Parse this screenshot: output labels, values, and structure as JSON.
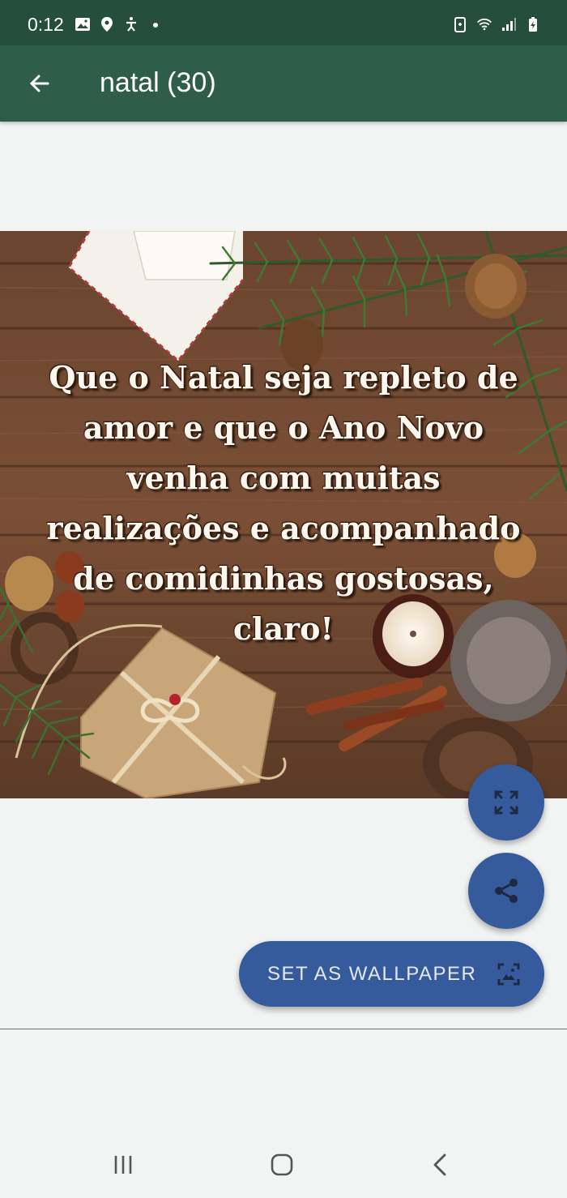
{
  "status_bar": {
    "time": "0:12",
    "left_icons": [
      "gallery-icon",
      "location-icon",
      "accessibility-icon",
      "dot-icon"
    ],
    "right_icons": [
      "battery-saver-icon",
      "wifi-icon",
      "signal-icon",
      "battery-icon"
    ]
  },
  "app_bar": {
    "title": "natal (30)",
    "back_icon": "arrow-left-icon",
    "color": "#2e5e4a"
  },
  "wallpaper": {
    "quote": "Que o Natal seja repleto de amor e que o Ano Novo venha com muitas realizações e acompanhado de comidinhas gostosas, claro!"
  },
  "actions": {
    "fullscreen_icon": "fullscreen-icon",
    "share_icon": "share-icon",
    "set_wallpaper_label": "SET AS WALLPAPER",
    "set_wallpaper_icon": "wallpaper-icon",
    "accent_color": "#365b9c"
  },
  "nav_bar": {
    "items": [
      "recent-apps-icon",
      "home-icon",
      "back-icon"
    ]
  }
}
